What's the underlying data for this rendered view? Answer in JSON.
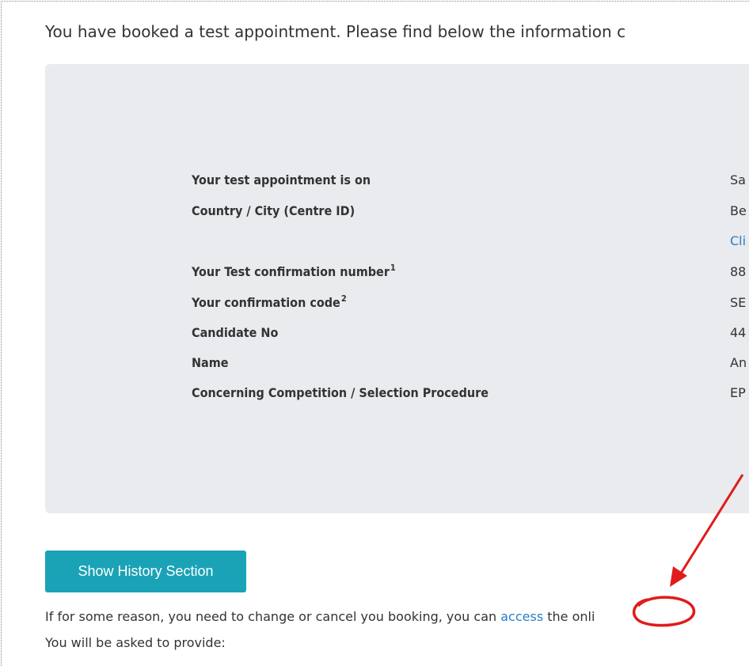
{
  "intro": "You have booked a test appointment. Please find below the information c",
  "details": {
    "rows": [
      {
        "label": "Your test appointment is on",
        "sup": "",
        "value": "Sa"
      },
      {
        "label": "Country / City (Centre ID)",
        "sup": "",
        "value": "Be"
      },
      {
        "label": "",
        "sup": "",
        "value": "Cli"
      },
      {
        "label": "Your Test confirmation number",
        "sup": "1",
        "value": "88"
      },
      {
        "label": "Your confirmation code",
        "sup": "2",
        "value": "SE"
      },
      {
        "label": "Candidate No",
        "sup": "",
        "value": "44"
      },
      {
        "label": "Name",
        "sup": "",
        "value": "An"
      },
      {
        "label": "Concerning Competition / Selection Procedure",
        "sup": "",
        "value": "EP"
      }
    ]
  },
  "history_button": "Show History Section",
  "change_text": {
    "before": "If for some reason, you need to change or cancel you booking, you can ",
    "link": "access",
    "after": " the onli"
  },
  "provide_text": "You will be asked to provide:",
  "colors": {
    "panel": "#e9ebee",
    "button": "#1aa2b6",
    "link": "#2a7ec8",
    "annotation": "#e01b1b"
  }
}
